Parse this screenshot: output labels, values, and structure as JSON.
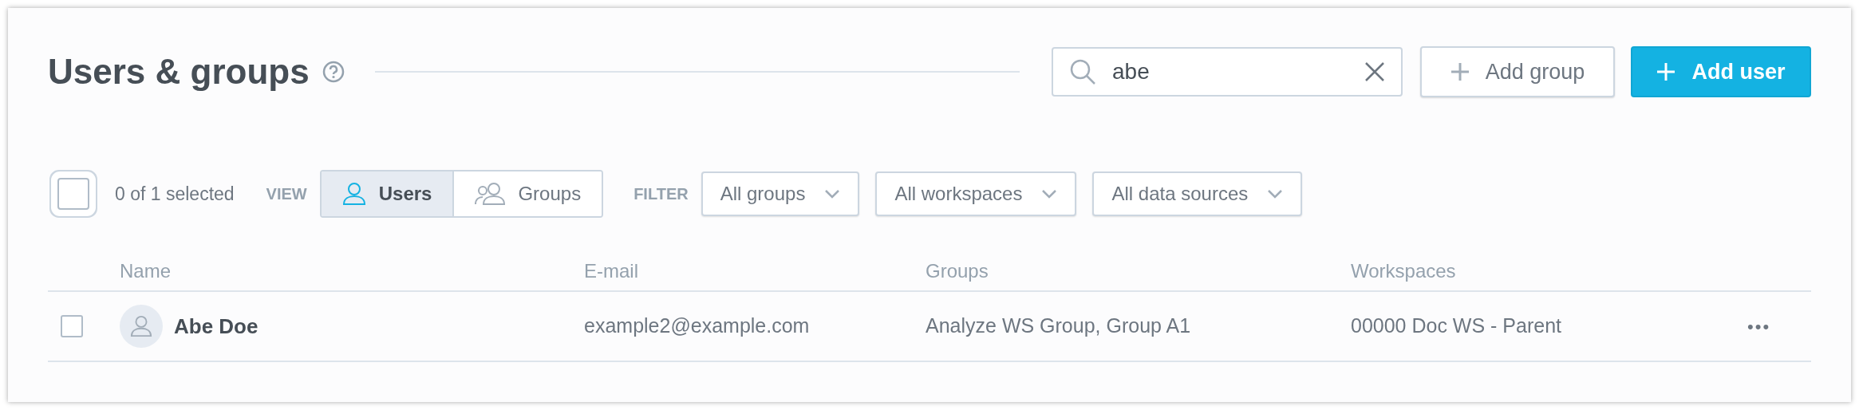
{
  "header": {
    "title": "Users & groups",
    "search": {
      "value": "abe"
    },
    "buttons": [
      {
        "kind": "secondary",
        "label": "Add group"
      },
      {
        "kind": "primary",
        "label": "Add user"
      }
    ]
  },
  "toolbar": {
    "select_all": {
      "checked": false
    },
    "selection_count": "0 of 1 selected",
    "view_label": "VIEW",
    "views": [
      {
        "kind": "user",
        "label": "Users",
        "selected": true
      },
      {
        "kind": "group",
        "label": "Groups",
        "selected": false
      }
    ],
    "filter_label": "FILTER",
    "filters": [
      "All groups",
      "All workspaces",
      "All data sources"
    ]
  },
  "table": {
    "columns": [
      "Name",
      "E-mail",
      "Groups",
      "Workspaces"
    ],
    "rows": [
      {
        "checked": false,
        "name": "Abe Doe",
        "email": "example2@example.com",
        "groups": "Analyze WS Group, Group A1",
        "workspaces": "00000 Doc WS - Parent",
        "menu": "•••"
      }
    ]
  }
}
